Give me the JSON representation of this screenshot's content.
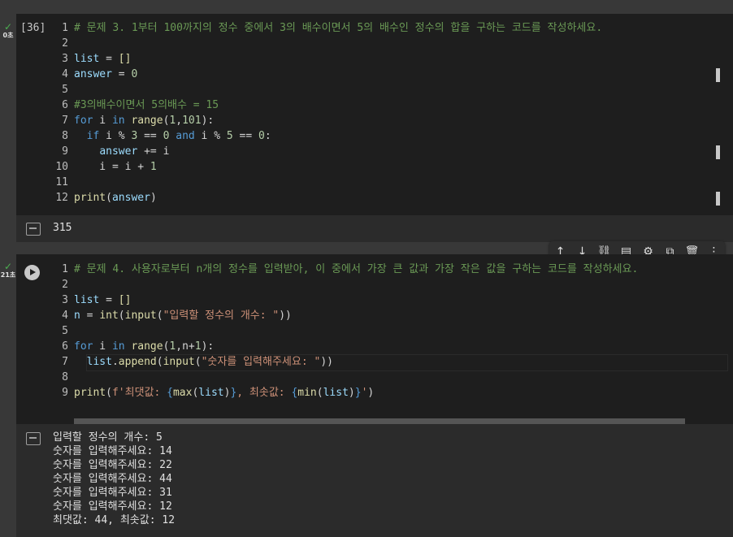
{
  "cell1": {
    "status_check": "✓",
    "status_time": "0초",
    "exec_count": "[36]",
    "lines": [
      {
        "n": "1",
        "t": [
          [
            "cm",
            "# 문제 3. 1부터 100까지의 정수 중에서 3의 배수이면서 5의 배수인 정수의 합을 구하는 코드를 작성하세요."
          ]
        ]
      },
      {
        "n": "2",
        "t": []
      },
      {
        "n": "3",
        "t": [
          [
            "var",
            "list"
          ],
          [
            "op",
            " = "
          ],
          [
            "fn",
            "[]"
          ]
        ]
      },
      {
        "n": "4",
        "t": [
          [
            "var",
            "answer"
          ],
          [
            "op",
            " = "
          ],
          [
            "num",
            "0"
          ]
        ]
      },
      {
        "n": "5",
        "t": []
      },
      {
        "n": "6",
        "t": [
          [
            "cm",
            "#3의배수이면서 5의배수 = 15"
          ]
        ]
      },
      {
        "n": "7",
        "t": [
          [
            "kw",
            "for"
          ],
          [
            "op",
            " i "
          ],
          [
            "kw",
            "in"
          ],
          [
            "op",
            " "
          ],
          [
            "fn",
            "range"
          ],
          [
            "op",
            "("
          ],
          [
            "num",
            "1"
          ],
          [
            "op",
            ","
          ],
          [
            "num",
            "101"
          ],
          [
            "op",
            "):"
          ]
        ]
      },
      {
        "n": "8",
        "t": [
          [
            "op",
            "  "
          ],
          [
            "kw",
            "if"
          ],
          [
            "op",
            " i % "
          ],
          [
            "num",
            "3"
          ],
          [
            "op",
            " == "
          ],
          [
            "num",
            "0"
          ],
          [
            "op",
            " "
          ],
          [
            "kw",
            "and"
          ],
          [
            "op",
            " i % "
          ],
          [
            "num",
            "5"
          ],
          [
            "op",
            " == "
          ],
          [
            "num",
            "0"
          ],
          [
            "op",
            ":"
          ]
        ]
      },
      {
        "n": "9",
        "t": [
          [
            "op",
            "    "
          ],
          [
            "var",
            "answer"
          ],
          [
            "op",
            " += i"
          ]
        ]
      },
      {
        "n": "10",
        "t": [
          [
            "op",
            "    i = i + "
          ],
          [
            "num",
            "1"
          ]
        ]
      },
      {
        "n": "11",
        "t": []
      },
      {
        "n": "12",
        "t": [
          [
            "fn",
            "print"
          ],
          [
            "op",
            "("
          ],
          [
            "var",
            "answer"
          ],
          [
            "op",
            ")"
          ]
        ]
      }
    ],
    "output": [
      "315"
    ]
  },
  "cell2": {
    "status_check": "✓",
    "status_time": "21초",
    "lines": [
      {
        "n": "1",
        "t": [
          [
            "cm",
            "# 문제 4. 사용자로부터 n개의 정수를 입력받아, 이 중에서 가장 큰 값과 가장 작은 값을 구하는 코드를 작성하세요."
          ]
        ]
      },
      {
        "n": "2",
        "t": []
      },
      {
        "n": "3",
        "t": [
          [
            "var",
            "list"
          ],
          [
            "op",
            " = "
          ],
          [
            "fn",
            "[]"
          ]
        ]
      },
      {
        "n": "4",
        "t": [
          [
            "var",
            "n"
          ],
          [
            "op",
            " = "
          ],
          [
            "fn",
            "int"
          ],
          [
            "op",
            "("
          ],
          [
            "fn",
            "input"
          ],
          [
            "op",
            "("
          ],
          [
            "str",
            "\"입력할 정수의 개수: \""
          ],
          [
            "op",
            "))"
          ]
        ]
      },
      {
        "n": "5",
        "t": []
      },
      {
        "n": "6",
        "t": [
          [
            "kw",
            "for"
          ],
          [
            "op",
            " i "
          ],
          [
            "kw",
            "in"
          ],
          [
            "op",
            " "
          ],
          [
            "fn",
            "range"
          ],
          [
            "op",
            "("
          ],
          [
            "num",
            "1"
          ],
          [
            "op",
            ",n+"
          ],
          [
            "num",
            "1"
          ],
          [
            "op",
            "):"
          ]
        ]
      },
      {
        "n": "7",
        "t": [
          [
            "op",
            "  "
          ],
          [
            "var",
            "list"
          ],
          [
            "op",
            "."
          ],
          [
            "fn",
            "append"
          ],
          [
            "op",
            "("
          ],
          [
            "fn",
            "input"
          ],
          [
            "op",
            "("
          ],
          [
            "str",
            "\"숫자를 입력해주세요: \""
          ],
          [
            "op",
            "))"
          ]
        ]
      },
      {
        "n": "8",
        "t": []
      },
      {
        "n": "9",
        "t": [
          [
            "fn",
            "print"
          ],
          [
            "op",
            "("
          ],
          [
            "str",
            "f'최댓값: "
          ],
          [
            "kw",
            "{"
          ],
          [
            "fn",
            "max"
          ],
          [
            "op",
            "("
          ],
          [
            "var",
            "list"
          ],
          [
            "op",
            ")"
          ],
          [
            "kw",
            "}"
          ],
          [
            "str",
            ", 최솟값: "
          ],
          [
            "kw",
            "{"
          ],
          [
            "fn",
            "min"
          ],
          [
            "op",
            "("
          ],
          [
            "var",
            "list"
          ],
          [
            "op",
            ")"
          ],
          [
            "kw",
            "}"
          ],
          [
            "str",
            "'"
          ],
          [
            "op",
            ")"
          ]
        ]
      }
    ],
    "output": [
      "입력할 정수의 개수: 5",
      "숫자를 입력해주세요: 14",
      "숫자를 입력해주세요: 22",
      "숫자를 입력해주세요: 44",
      "숫자를 입력해주세요: 31",
      "숫자를 입력해주세요: 12",
      "최댓값: 44, 최솟값: 12"
    ]
  },
  "toolbar": {
    "icons": [
      {
        "name": "move-up-icon",
        "glyph": "↑"
      },
      {
        "name": "move-down-icon",
        "glyph": "↓"
      },
      {
        "name": "link-icon",
        "glyph": "⛓"
      },
      {
        "name": "comment-icon",
        "glyph": "▤"
      },
      {
        "name": "settings-icon",
        "glyph": "⚙"
      },
      {
        "name": "mirror-cell-icon",
        "glyph": "⧉"
      },
      {
        "name": "delete-icon",
        "glyph": "🗑"
      },
      {
        "name": "more-icon",
        "glyph": "⋮"
      }
    ]
  },
  "colors": {
    "background": "#383838",
    "cell": "#1e1e1e",
    "output": "#2b2b2b",
    "success": "#4caf50"
  }
}
